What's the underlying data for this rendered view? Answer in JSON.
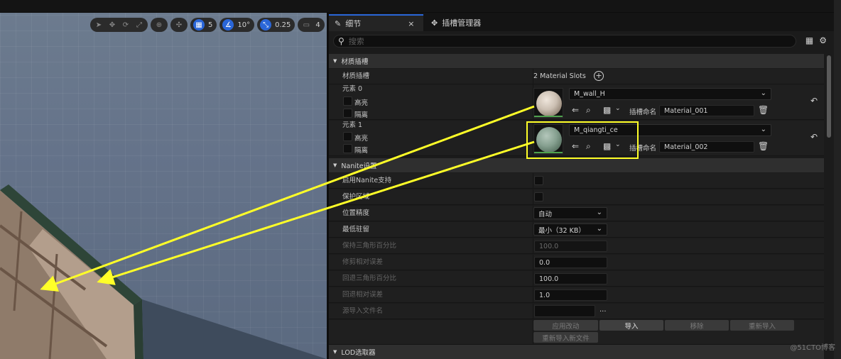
{
  "viewport_toolbar": {
    "grid_size": "5",
    "rotation_snap": "10°",
    "scale_snap": "0.25",
    "camera_speed": "4"
  },
  "tabs": [
    {
      "label": "细节",
      "close": "×"
    },
    {
      "label": "插槽管理器"
    }
  ],
  "search": {
    "placeholder": "搜索"
  },
  "material_section": {
    "title": "材质插槽",
    "row_label": "材质插槽",
    "slot_count": "2 Material Slots",
    "elements": [
      {
        "label": "元素 0",
        "highlight": "高亮",
        "isolate": "隔离",
        "material": "M_wall_H",
        "slot_label": "插槽命名",
        "slot_name": "Material_001"
      },
      {
        "label": "元素 1",
        "highlight": "高亮",
        "isolate": "隔离",
        "material": "M_qiangti_ce",
        "slot_label": "插槽命名",
        "slot_name": "Material_002"
      }
    ]
  },
  "nanite_section": {
    "title": "Nanite设置",
    "rows": [
      {
        "label": "启用Nanite支持"
      },
      {
        "label": "保护区域"
      },
      {
        "label": "位置精度",
        "value": "自动"
      },
      {
        "label": "最低驻留",
        "value": "最小（32 KB）"
      },
      {
        "label": "保持三角形百分比",
        "value": "100.0"
      },
      {
        "label": "修剪相对误差",
        "value": "0.0"
      },
      {
        "label": "回退三角形百分比",
        "value": "100.0"
      },
      {
        "label": "回退相对误差",
        "value": "1.0"
      },
      {
        "label": "源导入文件名",
        "value": "",
        "ellipsis": "..."
      }
    ],
    "buttons": {
      "apply": "应用改动",
      "import": "导入",
      "remove": "移除",
      "reimport": "重新导入",
      "reimport_new": "重新导入新文件"
    }
  },
  "lod_section": {
    "title": "LOD选取器"
  },
  "watermark": "@51CTO博客",
  "colors": {
    "accent": "#2a66d8",
    "annotation": "#ffff28",
    "valid_bar": "#4ea14e"
  }
}
